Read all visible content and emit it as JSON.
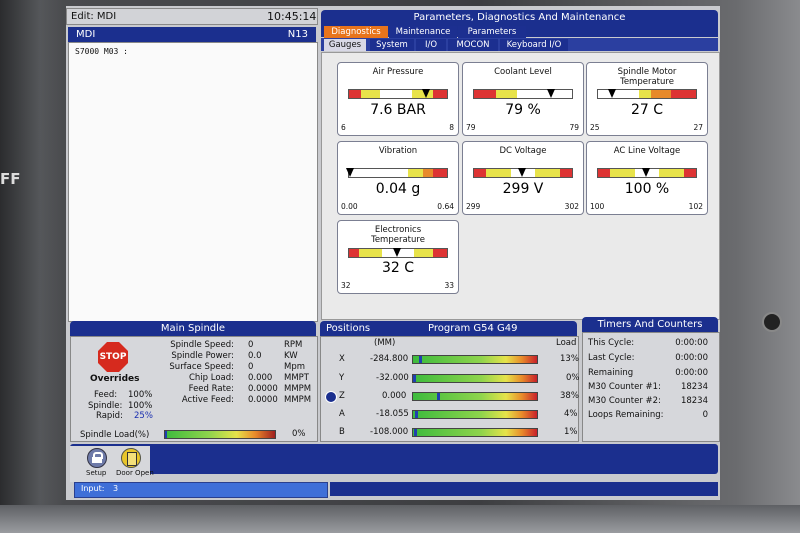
{
  "mdi": {
    "edit_label": "Edit: MDI",
    "clock": "10:45:14",
    "title": "MDI",
    "block": "N13",
    "code": "S7000 M03 :"
  },
  "pdm": {
    "title": "Parameters, Diagnostics And Maintenance",
    "tabs": [
      "Diagnostics",
      "Maintenance",
      "Parameters"
    ],
    "subtabs": [
      "Gauges",
      "System",
      "I/O",
      "MOCON",
      "Keyboard I/O"
    ]
  },
  "gauges": [
    {
      "title": "Air Pressure",
      "value": "7.6 BAR",
      "min": "6",
      "max": "8",
      "level": 0.8
    },
    {
      "title": "Coolant Level",
      "value": "79  %",
      "min": "79",
      "max": "79",
      "level": 0.8
    },
    {
      "title": "Spindle Motor Temperature",
      "value": "27 C",
      "min": "25",
      "max": "27",
      "level": 0.15
    },
    {
      "title": "Vibration",
      "value": "0.04 g",
      "min": "0.00",
      "max": "0.64",
      "level": 0.02
    },
    {
      "title": "DC Voltage",
      "value": "299 V",
      "min": "299",
      "max": "302",
      "level": 0.5
    },
    {
      "title": "AC Line Voltage",
      "value": "100  %",
      "min": "100",
      "max": "102",
      "level": 0.5
    },
    {
      "title": "Electronics Temperature",
      "value": "32 C",
      "min": "32",
      "max": "33",
      "level": 0.5
    }
  ],
  "spindle": {
    "title": "Main Spindle",
    "stop_label": "STOP",
    "overrides_label": "Overrides",
    "overrides": [
      {
        "label": "Feed:",
        "value": "100%"
      },
      {
        "label": "Spindle:",
        "value": "100%"
      },
      {
        "label": "Rapid:",
        "value": "25%"
      }
    ],
    "stats": [
      {
        "label": "Spindle Speed:",
        "value": "0",
        "unit": "RPM"
      },
      {
        "label": "Spindle Power:",
        "value": "0.0",
        "unit": "KW"
      },
      {
        "label": "Surface Speed:",
        "value": "0",
        "unit": "Mpm"
      },
      {
        "label": "Chip Load:",
        "value": "0.000",
        "unit": "MMPT"
      },
      {
        "label": "Feed Rate:",
        "value": "0.0000",
        "unit": "MMPM"
      },
      {
        "label": "Active Feed:",
        "value": "0.0000",
        "unit": "MMPM"
      }
    ],
    "load_label": "Spindle Load(%)",
    "load_value": "0%"
  },
  "positions": {
    "title": "Positions",
    "program": "Program G54 G49",
    "units": "(MM)",
    "load_header": "Load",
    "axes": [
      {
        "name": "X",
        "value": "-284.800",
        "load": "13%",
        "pos": 0.05
      },
      {
        "name": "Y",
        "value": "-32.000",
        "load": "0%",
        "pos": 0.0
      },
      {
        "name": "Z",
        "value": "0.000",
        "load": "38%",
        "pos": 0.2
      },
      {
        "name": "A",
        "value": "-18.055",
        "load": "4%",
        "pos": 0.02
      },
      {
        "name": "B",
        "value": "-108.000",
        "load": "1%",
        "pos": 0.01
      }
    ]
  },
  "timers": {
    "title": "Timers And Counters",
    "rows": [
      {
        "label": "This Cycle:",
        "value": "0:00:00"
      },
      {
        "label": "Last Cycle:",
        "value": "0:00:00"
      },
      {
        "label": "Remaining",
        "value": "0:00:00"
      },
      {
        "label": "M30 Counter #1:",
        "value": "18234"
      },
      {
        "label": "M30 Counter #2:",
        "value": "18234"
      },
      {
        "label": "Loops Remaining:",
        "value": "0"
      }
    ]
  },
  "footer": {
    "setup_label": "Setup",
    "door_label": "Door Open",
    "input_label": "Input:",
    "input_value": "3"
  },
  "colors": {
    "header": "#1b2f8e",
    "active_tab": "#e8741c",
    "panel_bg": "#c9cace"
  }
}
